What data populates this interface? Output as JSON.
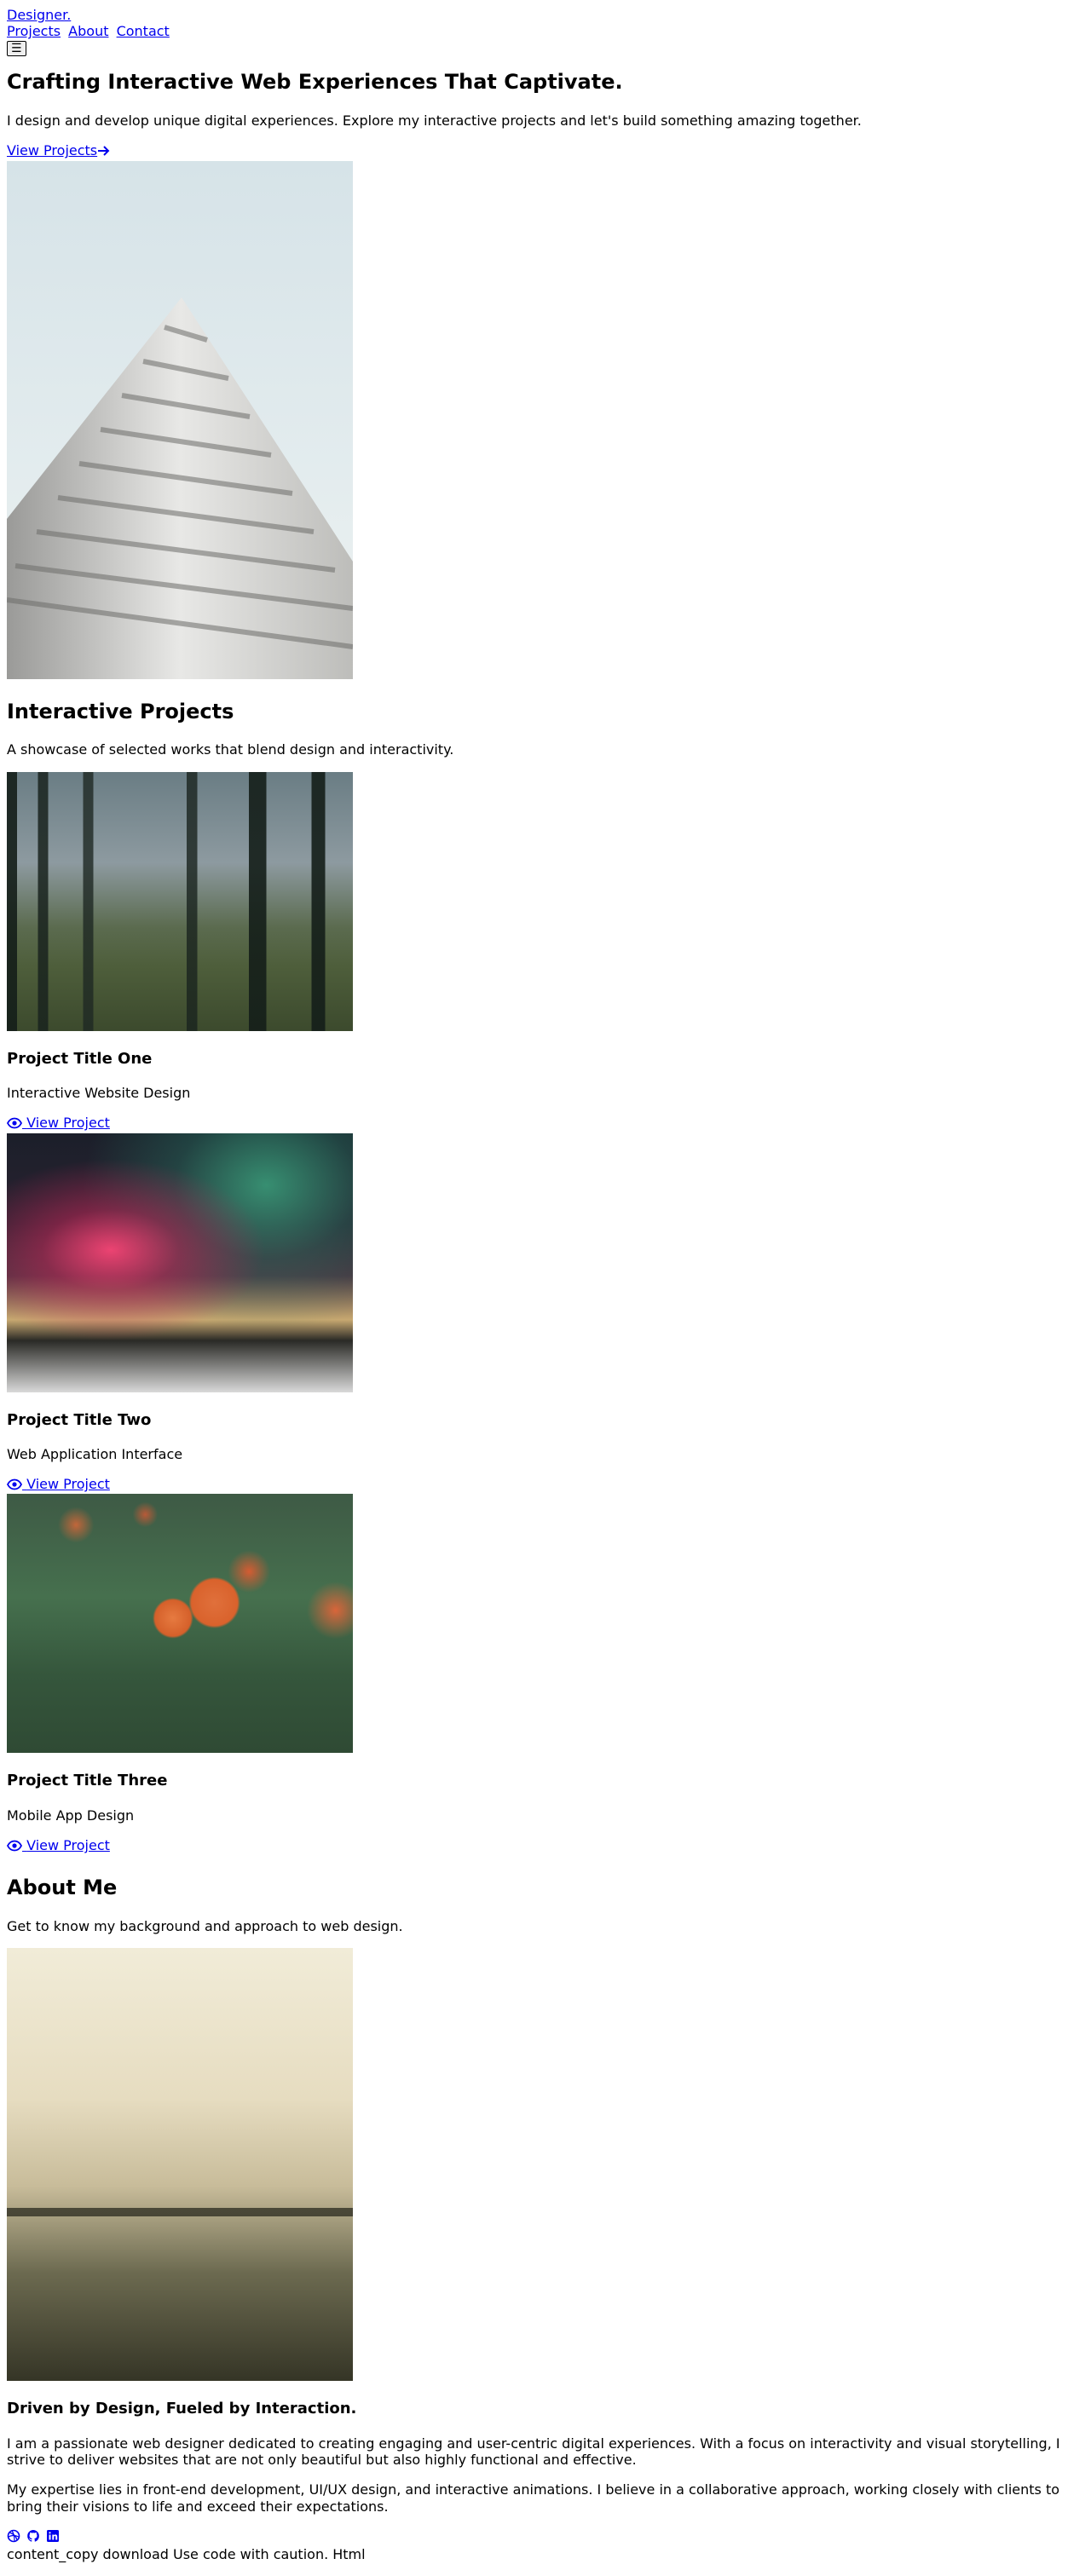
{
  "header": {
    "logo": "Designer.",
    "nav": [
      "Projects",
      "About",
      "Contact"
    ],
    "menu_glyph": "☰"
  },
  "hero": {
    "title": "Crafting Interactive Web Experiences That Captivate.",
    "subtitle": "I design and develop unique digital experiences. Explore my interactive projects and let's build something amazing together.",
    "cta": "View Projects"
  },
  "projects": {
    "title": "Interactive Projects",
    "subtitle": "A showcase of selected works that blend design and interactivity.",
    "items": [
      {
        "title": "Project Title One",
        "category": "Interactive Website Design",
        "link": "View Project"
      },
      {
        "title": "Project Title Two",
        "category": "Web Application Interface",
        "link": "View Project"
      },
      {
        "title": "Project Title Three",
        "category": "Mobile App Design",
        "link": "View Project"
      }
    ]
  },
  "about": {
    "title": "About Me",
    "subtitle": "Get to know my background and approach to web design.",
    "heading": "Driven by Design, Fueled by Interaction.",
    "paragraphs": [
      "I am a passionate web designer dedicated to creating engaging and user-centric digital experiences. With a focus on interactivity and visual storytelling, I strive to deliver websites that are not only beautiful but also highly functional and effective.",
      "My expertise lies in front-end development, UI/UX design, and interactive animations. I believe in a collaborative approach, working closely with clients to bring their visions to life and exceed their expectations."
    ],
    "social_icons": [
      "dribbble-icon",
      "github-icon",
      "linkedin-icon"
    ]
  },
  "footer": {
    "text": "content_copy download Use code with caution. Html"
  },
  "colors": {
    "link": "#0000ee",
    "text": "#000000",
    "background": "#ffffff"
  }
}
